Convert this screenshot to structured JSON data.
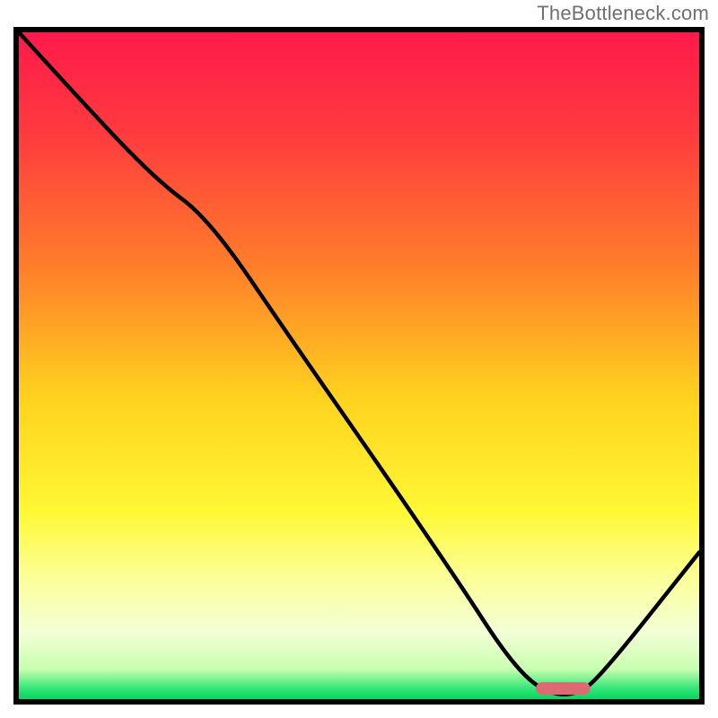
{
  "attribution": "TheBottleneck.com",
  "colors": {
    "frame": "#000000",
    "curve": "#000000",
    "marker_fill": "#dc6a73",
    "gradient_stops": [
      {
        "offset": 0.0,
        "color": "#ff1a4b"
      },
      {
        "offset": 0.15,
        "color": "#ff3a3f"
      },
      {
        "offset": 0.35,
        "color": "#ff7d2a"
      },
      {
        "offset": 0.55,
        "color": "#ffd31f"
      },
      {
        "offset": 0.72,
        "color": "#fff835"
      },
      {
        "offset": 0.82,
        "color": "#fbff9a"
      },
      {
        "offset": 0.9,
        "color": "#f3ffd6"
      },
      {
        "offset": 0.955,
        "color": "#c8ffb0"
      },
      {
        "offset": 0.985,
        "color": "#2ee676"
      },
      {
        "offset": 1.0,
        "color": "#08d361"
      }
    ]
  },
  "chart_data": {
    "type": "line",
    "xlim": [
      0,
      100
    ],
    "ylim": [
      0,
      100
    ],
    "title": "",
    "xlabel": "",
    "ylabel": "",
    "series": [
      {
        "name": "bottleneck-curve",
        "x": [
          0,
          8,
          20,
          28,
          40,
          55,
          65,
          72,
          77,
          82,
          86,
          100
        ],
        "y": [
          100,
          91,
          78,
          72,
          54,
          32,
          17,
          6,
          1,
          0.5,
          4,
          22
        ]
      }
    ],
    "marker": {
      "name": "optimal-range",
      "x_start": 76,
      "x_end": 84,
      "y": 1.6
    }
  }
}
